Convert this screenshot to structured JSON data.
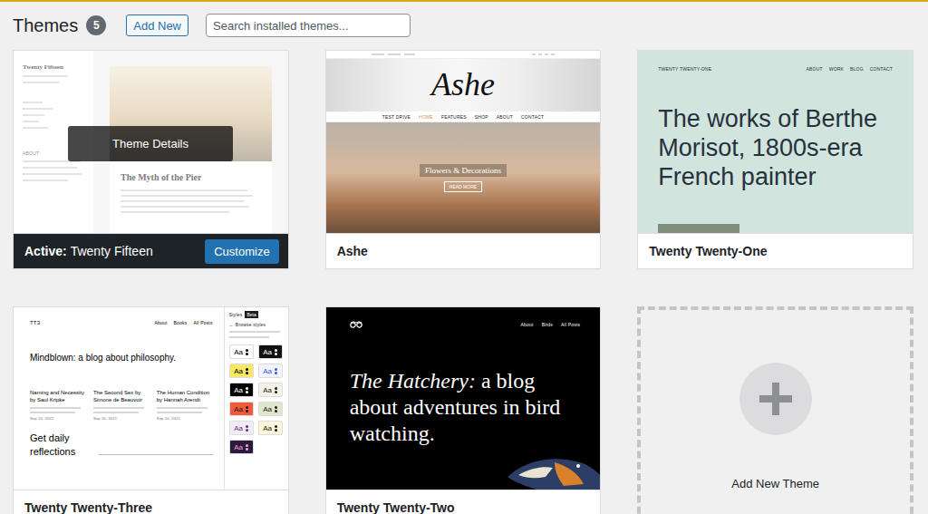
{
  "header": {
    "title": "Themes",
    "count": "5",
    "add_button": "Add New",
    "search": {
      "placeholder": "Search installed themes..."
    }
  },
  "themes": [
    {
      "name": "Twenty Fifteen",
      "active": true,
      "active_label": "Active:",
      "hovered": true,
      "details_label": "Theme Details",
      "action": "Customize",
      "preview": {
        "kind": "fifteen",
        "site_title": "Twenty Fifteen",
        "sidebar_heading": "ABOUT",
        "post_title": "The Myth of the Pier"
      }
    },
    {
      "name": "Ashe",
      "active": false,
      "hovered": false,
      "preview": {
        "kind": "ashe",
        "logo": "Ashe",
        "nav": [
          "TEST DRIVE",
          "HOME",
          "FEATURES",
          "SHOP",
          "ABOUT",
          "CONTACT"
        ],
        "slide_title": "Flowers & Decorations",
        "slide_button": "READ MORE"
      }
    },
    {
      "name": "Twenty Twenty-One",
      "active": false,
      "hovered": false,
      "preview": {
        "kind": "twentyone",
        "site_title": "TWENTY TWENTY-ONE",
        "nav": [
          "ABOUT",
          "WORK",
          "BLOG",
          "CONTACT"
        ],
        "headline": "The works of Berthe Morisot, 1800s-era French painter"
      }
    },
    {
      "name": "Twenty Twenty-Three",
      "active": false,
      "hovered": false,
      "preview": {
        "kind": "twentythree",
        "logo": "TT3",
        "nav": [
          "About",
          "Books",
          "All Posts"
        ],
        "headline": "Mindblown: a blog about philosophy.",
        "posts": [
          {
            "title": "Naming and Necessity by Saul Kripke",
            "date": "Sep 10, 2021"
          },
          {
            "title": "The Second Sex by Simone de Beauvoir",
            "date": "Sep 10, 2021"
          },
          {
            "title": "The Human Condition by Hannah Arendt",
            "date": "Sep 10, 2021"
          }
        ],
        "cta": "Get daily reflections",
        "panel": {
          "title": "Styles",
          "tag": "Beta",
          "back_icon": "←",
          "back": "Browse styles",
          "swatches": [
            {
              "label": "Aa",
              "color": "#ffffff",
              "ink": "#000000"
            },
            {
              "label": "Aa",
              "color": "#111111",
              "ink": "#ffffff"
            },
            {
              "label": "Aa",
              "color": "#f9e866",
              "ink": "#000000"
            },
            {
              "label": "Aa",
              "color": "#f2f4fd",
              "ink": "#3858e9"
            },
            {
              "label": "Aa",
              "color": "#000000",
              "ink": "#ffffff"
            },
            {
              "label": "Aa",
              "color": "#f6f1e7",
              "ink": "#1a1a1a"
            },
            {
              "label": "Aa",
              "color": "#ef5a3c",
              "ink": "#1a1a1a"
            },
            {
              "label": "Aa",
              "color": "#dfe6cc",
              "ink": "#1a1a1a"
            },
            {
              "label": "Aa",
              "color": "#f1edf6",
              "ink": "#6b2a7a"
            },
            {
              "label": "Aa",
              "color": "#fdf7d9",
              "ink": "#1a1a1a"
            },
            {
              "label": "Aa",
              "color": "#2b1a3d",
              "ink": "#f5a5d6"
            }
          ]
        }
      }
    },
    {
      "name": "Twenty Twenty-Two",
      "active": false,
      "hovered": false,
      "preview": {
        "kind": "twentytwo",
        "nav": [
          "About",
          "Birds",
          "All Posts"
        ],
        "headline_emphasis": "The Hatchery:",
        "headline_rest": " a blog about adventures in bird watching."
      }
    }
  ],
  "add_new": {
    "label": "Add New Theme"
  }
}
